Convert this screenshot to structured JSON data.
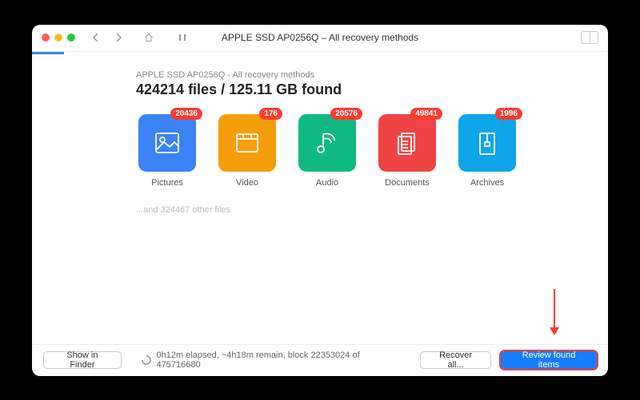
{
  "toolbar": {
    "title": "APPLE SSD AP0256Q – All recovery methods"
  },
  "header": {
    "subtitle": "APPLE SSD AP0256Q - All recovery methods",
    "main_stat": "424214 files / 125.11 GB found"
  },
  "tiles": [
    {
      "label": "Pictures",
      "count": "20436",
      "color": "#3b82f6",
      "icon": "image"
    },
    {
      "label": "Video",
      "count": "176",
      "color": "#f59e0b",
      "icon": "video"
    },
    {
      "label": "Audio",
      "count": "20576",
      "color": "#10b981",
      "icon": "audio"
    },
    {
      "label": "Documents",
      "count": "49841",
      "color": "#ef4444",
      "icon": "document"
    },
    {
      "label": "Archives",
      "count": "1996",
      "color": "#0ea5e9",
      "icon": "archive"
    }
  ],
  "other_files": "...and 324467 other files",
  "footer": {
    "show_in_finder": "Show in Finder",
    "status": "0h12m elapsed, ~4h18m remain, block 22353024 of 475716680",
    "recover_all": "Recover all...",
    "review": "Review found items"
  }
}
